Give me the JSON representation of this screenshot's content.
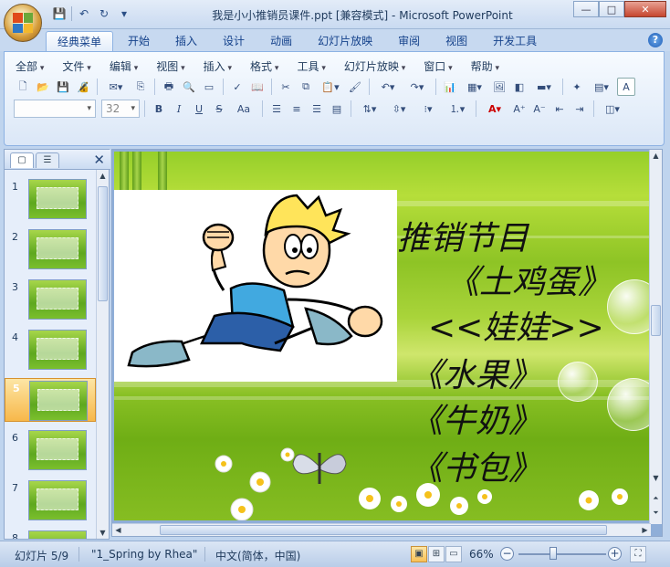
{
  "window": {
    "title": "我是小小推销员课件.ppt [兼容模式] - Microsoft PowerPoint",
    "minimize": "—",
    "maximize": "□",
    "close": "✕"
  },
  "quick_access": {
    "icons": [
      "save-icon",
      "undo-icon",
      "redo-icon",
      "customize-icon"
    ],
    "glyphs": {
      "save": "💾",
      "undo": "↶",
      "redo": "↻",
      "customize": "▾"
    }
  },
  "ribbon_tabs": [
    {
      "label": "经典菜单",
      "active": true
    },
    {
      "label": "开始",
      "active": false
    },
    {
      "label": "插入",
      "active": false
    },
    {
      "label": "设计",
      "active": false
    },
    {
      "label": "动画",
      "active": false
    },
    {
      "label": "幻灯片放映",
      "active": false
    },
    {
      "label": "审阅",
      "active": false
    },
    {
      "label": "视图",
      "active": false
    },
    {
      "label": "开发工具",
      "active": false
    }
  ],
  "help": "?",
  "menus": [
    "全部",
    "文件",
    "编辑",
    "视图",
    "插入",
    "格式",
    "工具",
    "幻灯片放映",
    "窗口",
    "帮助"
  ],
  "font_controls": {
    "font_name": "",
    "font_size": "32"
  },
  "format_buttons": {
    "bold": "B",
    "italic": "I",
    "underline": "U",
    "strike": "S",
    "case": "Aa"
  },
  "slide_panel": {
    "tab_outline": "▢",
    "tab_slides": "☰",
    "close": "✕",
    "slides": [
      {
        "num": "1",
        "selected": false
      },
      {
        "num": "2",
        "selected": false
      },
      {
        "num": "3",
        "selected": false
      },
      {
        "num": "4",
        "selected": false
      },
      {
        "num": "5",
        "selected": true
      },
      {
        "num": "6",
        "selected": false
      },
      {
        "num": "7",
        "selected": false
      },
      {
        "num": "8",
        "selected": false
      }
    ]
  },
  "slide": {
    "lines": [
      "推销节目",
      "《土鸡蛋》",
      "<<娃娃>>",
      "《水果》",
      "《牛奶》",
      "《书包》"
    ]
  },
  "status": {
    "slide_info": "幻灯片 5/9",
    "theme": "\"1_Spring by Rhea\"",
    "language": "中文(简体，中国)",
    "zoom": "66%",
    "zoom_out": "−",
    "zoom_in": "+",
    "zoom_level": 0.4
  },
  "colors": {
    "slide_green": "#8ec425",
    "selected_thumb": "#f7b84a",
    "ribbon_blue": "#c7d9f0"
  }
}
